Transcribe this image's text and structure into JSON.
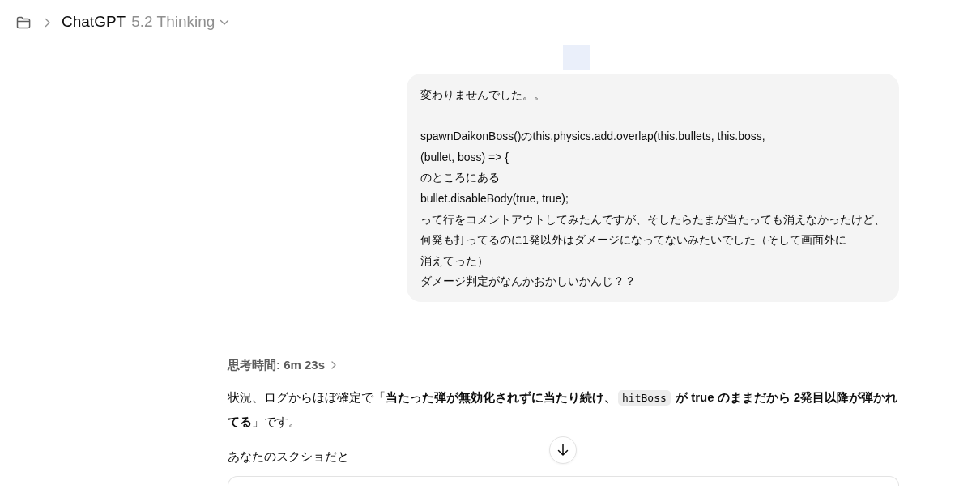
{
  "header": {
    "model_name": "ChatGPT",
    "model_variant": "5.2 Thinking"
  },
  "user_message": {
    "paragraphs": [
      {
        "lines": [
          "変わりませんでした。。"
        ]
      },
      {
        "lines": [
          "spawnDaikonBoss()のthis.physics.add.overlap(this.bullets, this.boss,",
          "(bullet, boss) => {",
          "のところにある",
          "bullet.disableBody(true, true);",
          "って行をコメントアウトしてみたんですが、そしたらたまが当たっても消えなかったけど、",
          "何発も打ってるのに1発以外はダメージになってないみたいでした（そして画面外に",
          "消えてった）",
          "ダメージ判定がなんかおかしいかんじ？？"
        ]
      }
    ]
  },
  "assistant": {
    "thinking_time": "思考時間: 6m 23s",
    "paragraphs": [
      {
        "runs": [
          {
            "kind": "text",
            "text": "状況、ログからほぼ確定で「"
          },
          {
            "kind": "bold",
            "text": "当たった弾が無効化されずに当たり続け、"
          },
          {
            "kind": "code",
            "text": "hitBoss"
          },
          {
            "kind": "bold",
            "text": " が true のままだから 2発目以降が弾かれてる"
          },
          {
            "kind": "text",
            "text": "」です。"
          }
        ]
      },
      {
        "runs": [
          {
            "kind": "text",
            "text": "あなたのスクショだと"
          }
        ]
      }
    ]
  }
}
